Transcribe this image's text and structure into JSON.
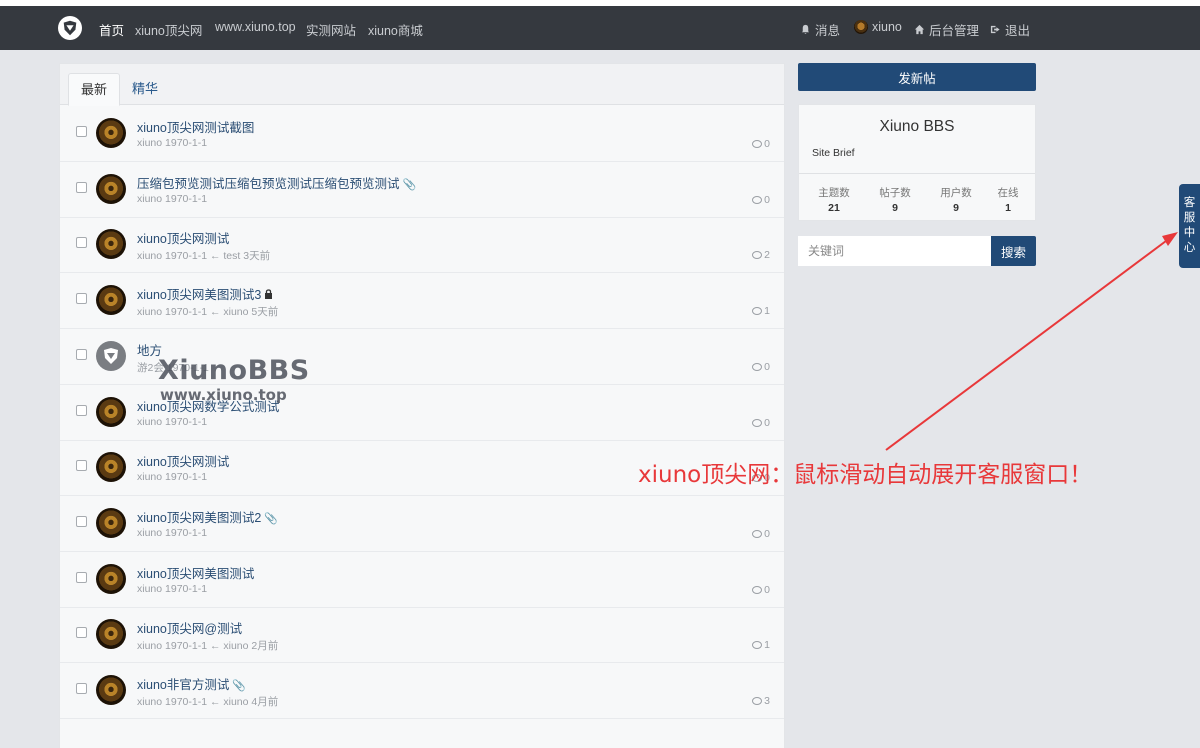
{
  "navbar": {
    "links": [
      "首页",
      "xiuno顶尖网",
      "www.xiuno.top",
      "实测网站",
      "xiuno商城"
    ],
    "right": {
      "messages": "消息",
      "username": "xiuno",
      "admin": "后台管理",
      "logout": "退出"
    }
  },
  "tabs": [
    "最新",
    "精华"
  ],
  "threads": [
    {
      "title": "xiuno顶尖网测试截图",
      "meta": "xiuno  1970-1-1",
      "comments": "0",
      "attach": false,
      "lock": false
    },
    {
      "title": "压缩包预览测试压缩包预览测试压缩包预览测试",
      "meta": "xiuno  1970-1-1",
      "comments": "0",
      "attach": true,
      "lock": false
    },
    {
      "title": "xiuno顶尖网测试",
      "meta": "xiuno  1970-1-1  ←  test  3天前",
      "comments": "2",
      "attach": false,
      "lock": false
    },
    {
      "title": "xiuno顶尖网美图测试3",
      "meta": "xiuno  1970-1-1  ←  xiuno  5天前",
      "comments": "1",
      "attach": false,
      "lock": true
    },
    {
      "title": "地方",
      "meta": "游2会  1970-1-1",
      "comments": "0",
      "attach": false,
      "lock": false
    },
    {
      "title": "xiuno顶尖网数学公式测试",
      "meta": "xiuno  1970-1-1",
      "comments": "0",
      "attach": false,
      "lock": false
    },
    {
      "title": "xiuno顶尖网测试",
      "meta": "xiuno  1970-1-1",
      "comments": "0",
      "attach": false,
      "lock": false
    },
    {
      "title": "xiuno顶尖网美图测试2",
      "meta": "xiuno  1970-1-1",
      "comments": "0",
      "attach": true,
      "lock": false
    },
    {
      "title": "xiuno顶尖网美图测试",
      "meta": "xiuno  1970-1-1",
      "comments": "0",
      "attach": false,
      "lock": false
    },
    {
      "title": "xiuno顶尖网@测试",
      "meta": "xiuno  1970-1-1  ←  xiuno  2月前",
      "comments": "1",
      "attach": false,
      "lock": false
    },
    {
      "title": "xiuno非官方测试",
      "meta": "xiuno  1970-1-1  ←  xiuno  4月前",
      "comments": "3",
      "attach": true,
      "lock": false
    }
  ],
  "watermark": {
    "line1": "XiunoBBS",
    "line2": "www.xiuno.top"
  },
  "sidebar": {
    "new_post": "发新帖",
    "site_name": "Xiuno BBS",
    "site_brief": "Site Brief",
    "stats": [
      {
        "label": "主题数",
        "value": "21"
      },
      {
        "label": "帖子数",
        "value": "9"
      },
      {
        "label": "用户数",
        "value": "9"
      },
      {
        "label": "在线",
        "value": "1"
      }
    ],
    "search_placeholder": "关键词",
    "search_button": "搜索"
  },
  "service_tab": "客服中心",
  "annotation": "xiuno顶尖网：鼠标滑动自动展开客服窗口！",
  "colors": {
    "navbar": "#35393f",
    "primary": "#214a77",
    "annotation": "#e8383a"
  }
}
